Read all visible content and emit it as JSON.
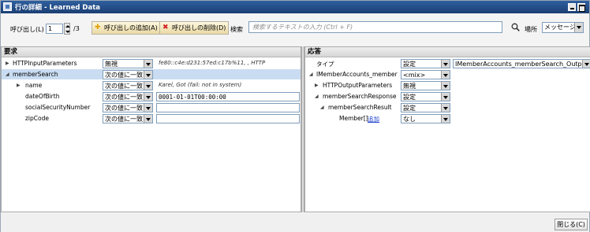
{
  "window": {
    "title": "行の詳細 - Learned Data"
  },
  "toolbar": {
    "call_label": "呼び出し(L)",
    "call_index": "1",
    "call_total": "/3",
    "add_call_label": "呼び出しの追加(A)",
    "delete_call_label": "呼び出しの削除(D)",
    "search_label": "検索",
    "search_placeholder": "検索するテキストの入力 (Ctrl + F)",
    "location_label": "場所",
    "location_value": "メッセージ"
  },
  "request": {
    "header": "要求",
    "rows": [
      {
        "name": "HTTPInputParameters",
        "match": "無視",
        "value": "fe80::c4e:d231:57ed:c17b%11, , HTTP"
      },
      {
        "name": "memberSearch",
        "match": "次の値に一致",
        "value": ""
      },
      {
        "name": "name",
        "match": "次の値に一致",
        "value": "Karel, Got (fail: not in system)"
      },
      {
        "name": "dateOfBirth",
        "match": "次の値に一致",
        "value": "0001-01-01T00:00:00"
      },
      {
        "name": "socialSecurityNumber",
        "match": "次の値に一致",
        "value": ""
      },
      {
        "name": "zipCode",
        "match": "次の値に一致",
        "value": ""
      }
    ]
  },
  "response": {
    "header": "応答",
    "rows": [
      {
        "name": "タイプ",
        "mode": "設定",
        "value": "IMemberAccounts_memberSearch_Output"
      },
      {
        "name": "IMemberAccounts_member",
        "mode": "<mix>"
      },
      {
        "name": "HTTPOutputParameters",
        "mode": "無視"
      },
      {
        "name": "memberSearchResponse",
        "mode": "設定"
      },
      {
        "name": "memberSearchResult",
        "mode": "設定"
      },
      {
        "name": "Member[]",
        "mode": "なし",
        "link": "追加"
      }
    ]
  },
  "footer": {
    "close_label": "閉じる(C)"
  },
  "colors": {
    "title_bar": "#1f4a86",
    "selected_row": "#c9dcf2",
    "link": "#1a3fc9"
  },
  "icons": {
    "add": "add-call-icon",
    "delete": "delete-call-icon",
    "search": "search-icon"
  }
}
